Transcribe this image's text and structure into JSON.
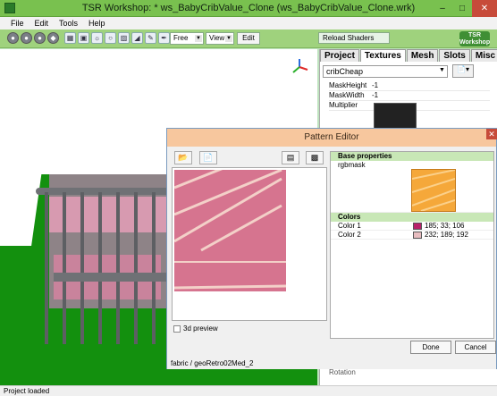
{
  "window": {
    "title": "TSR Workshop: * ws_BabyCribValue_Clone (ws_BabyCribValue_Clone.wrk)",
    "controls": [
      "minimize-icon",
      "maximize-icon",
      "close-icon"
    ]
  },
  "menu": [
    "File",
    "Edit",
    "Tools",
    "Help"
  ],
  "toolbar": {
    "mode_select": "Free",
    "view_select": "View",
    "edit_label": "Edit",
    "reload_label": "Reload Shaders",
    "logo_text": "TSR Workshop"
  },
  "tabs": [
    "Project",
    "Textures",
    "Mesh",
    "Slots",
    "Misc"
  ],
  "active_tab": "Textures",
  "texture_select": "cribCheap",
  "properties": [
    {
      "key": "MaskHeight",
      "value": "-1"
    },
    {
      "key": "MaskWidth",
      "value": "-1"
    },
    {
      "key": "Multiplier",
      "value": ""
    }
  ],
  "dialog": {
    "title": "Pattern Editor",
    "preview_label": "3d preview",
    "categories": {
      "base": "Base properties",
      "colors": "Colors"
    },
    "rgbmask_label": "rgbmask",
    "colors": [
      {
        "label": "Color 1",
        "value": "185; 33; 106",
        "hex": "#b9216a"
      },
      {
        "label": "Color 2",
        "value": "232; 189; 192",
        "hex": "#e8bdc0"
      }
    ],
    "done_label": "Done",
    "cancel_label": "Cancel",
    "status": "fabric / geoRetro02Med_2"
  },
  "status_bar": "Project loaded",
  "panel_bottom": "Rotation"
}
